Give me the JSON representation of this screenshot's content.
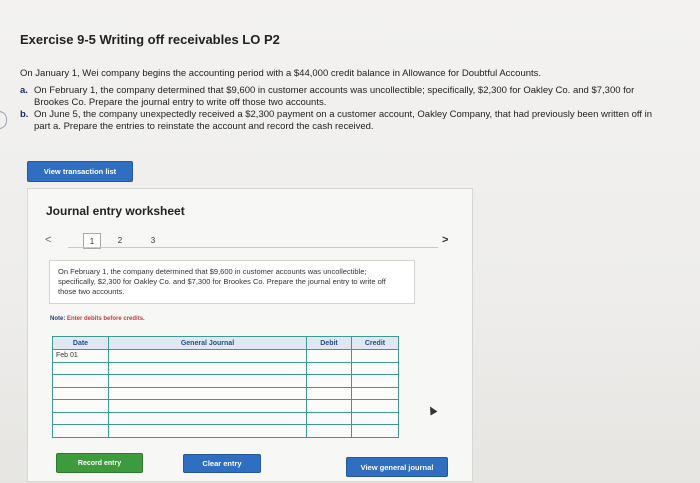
{
  "exercise_title": "Exercise 9-5 Writing off receivables LO P2",
  "intro": "On January 1, Wei company begins the accounting period with a $44,000 credit balance in Allowance for Doubtful Accounts.",
  "parts": [
    {
      "label": "a.",
      "text": "On February 1, the company determined that $9,600 in customer accounts was uncollectible; specifically, $2,300 for Oakley Co. and $7,300 for Brookes Co. Prepare the journal entry to write off those two accounts."
    },
    {
      "label": "b.",
      "text": "On June 5, the company unexpectedly received a $2,300 payment on a customer account, Oakley Company, that had previously been written off in part a. Prepare the entries to reinstate the account and record the cash received."
    }
  ],
  "view_transaction_list": "View transaction list",
  "worksheet": {
    "title": "Journal entry worksheet",
    "prev": "<",
    "next": ">",
    "pages": [
      "1",
      "2",
      "3"
    ],
    "active_page": "1",
    "description": "On February 1, the company determined that $9,600 in customer accounts was uncollectible; specifically, $2,300 for Oakley Co. and $7,300 for Brookes Co. Prepare the journal entry to write off those two accounts.",
    "note_label": "Note:",
    "note_text": "Enter debits before credits.",
    "table": {
      "headers": [
        "Date",
        "General Journal",
        "Debit",
        "Credit"
      ],
      "rows": [
        {
          "date": "Feb 01",
          "journal": "",
          "debit": "",
          "credit": ""
        },
        {
          "date": "",
          "journal": "",
          "debit": "",
          "credit": ""
        },
        {
          "date": "",
          "journal": "",
          "debit": "",
          "credit": ""
        },
        {
          "date": "",
          "journal": "",
          "debit": "",
          "credit": ""
        },
        {
          "date": "",
          "journal": "",
          "debit": "",
          "credit": ""
        },
        {
          "date": "",
          "journal": "",
          "debit": "",
          "credit": ""
        },
        {
          "date": "",
          "journal": "",
          "debit": "",
          "credit": ""
        }
      ]
    },
    "record_entry": "Record entry",
    "clear_entry": "Clear entry",
    "view_general_journal": "View general journal"
  },
  "colors": {
    "primary_button": "#2f6ec0",
    "green_button": "#3d9a3d",
    "table_border": "#3d9a8e",
    "note_red": "#c04040"
  }
}
